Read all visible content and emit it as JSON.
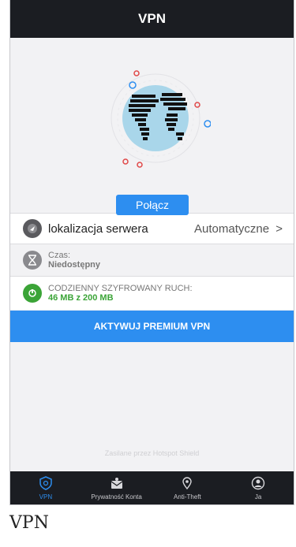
{
  "header": {
    "title": "VPN"
  },
  "hero": {
    "connect_label": "Połącz"
  },
  "server": {
    "label": "lokalizacja serwera",
    "value": "Automatyczne",
    "chevron": ">"
  },
  "time": {
    "label": "Czas:",
    "value": "Niedostępny"
  },
  "traffic": {
    "label": "CODZIENNY SZYFROWANY RUCH:",
    "value": "46 MB z 200 MB"
  },
  "premium": {
    "label": "AKTYWUJ PREMIUM VPN"
  },
  "footer": {
    "powered": "Zasilane przez Hotspot Shield"
  },
  "tabs": [
    {
      "label": "VPN",
      "icon": "shield-icon",
      "active": true
    },
    {
      "label": "Prywatność Konta",
      "icon": "privacy-icon",
      "active": false
    },
    {
      "label": "Anti-Theft",
      "icon": "location-pin-icon",
      "active": false
    },
    {
      "label": "Ja",
      "icon": "user-icon",
      "active": false
    }
  ],
  "caption": "VPN",
  "colors": {
    "accent": "#2d8ef0",
    "dark": "#1b1d22",
    "green": "#3ba437",
    "globe": "#a9d6ea"
  }
}
